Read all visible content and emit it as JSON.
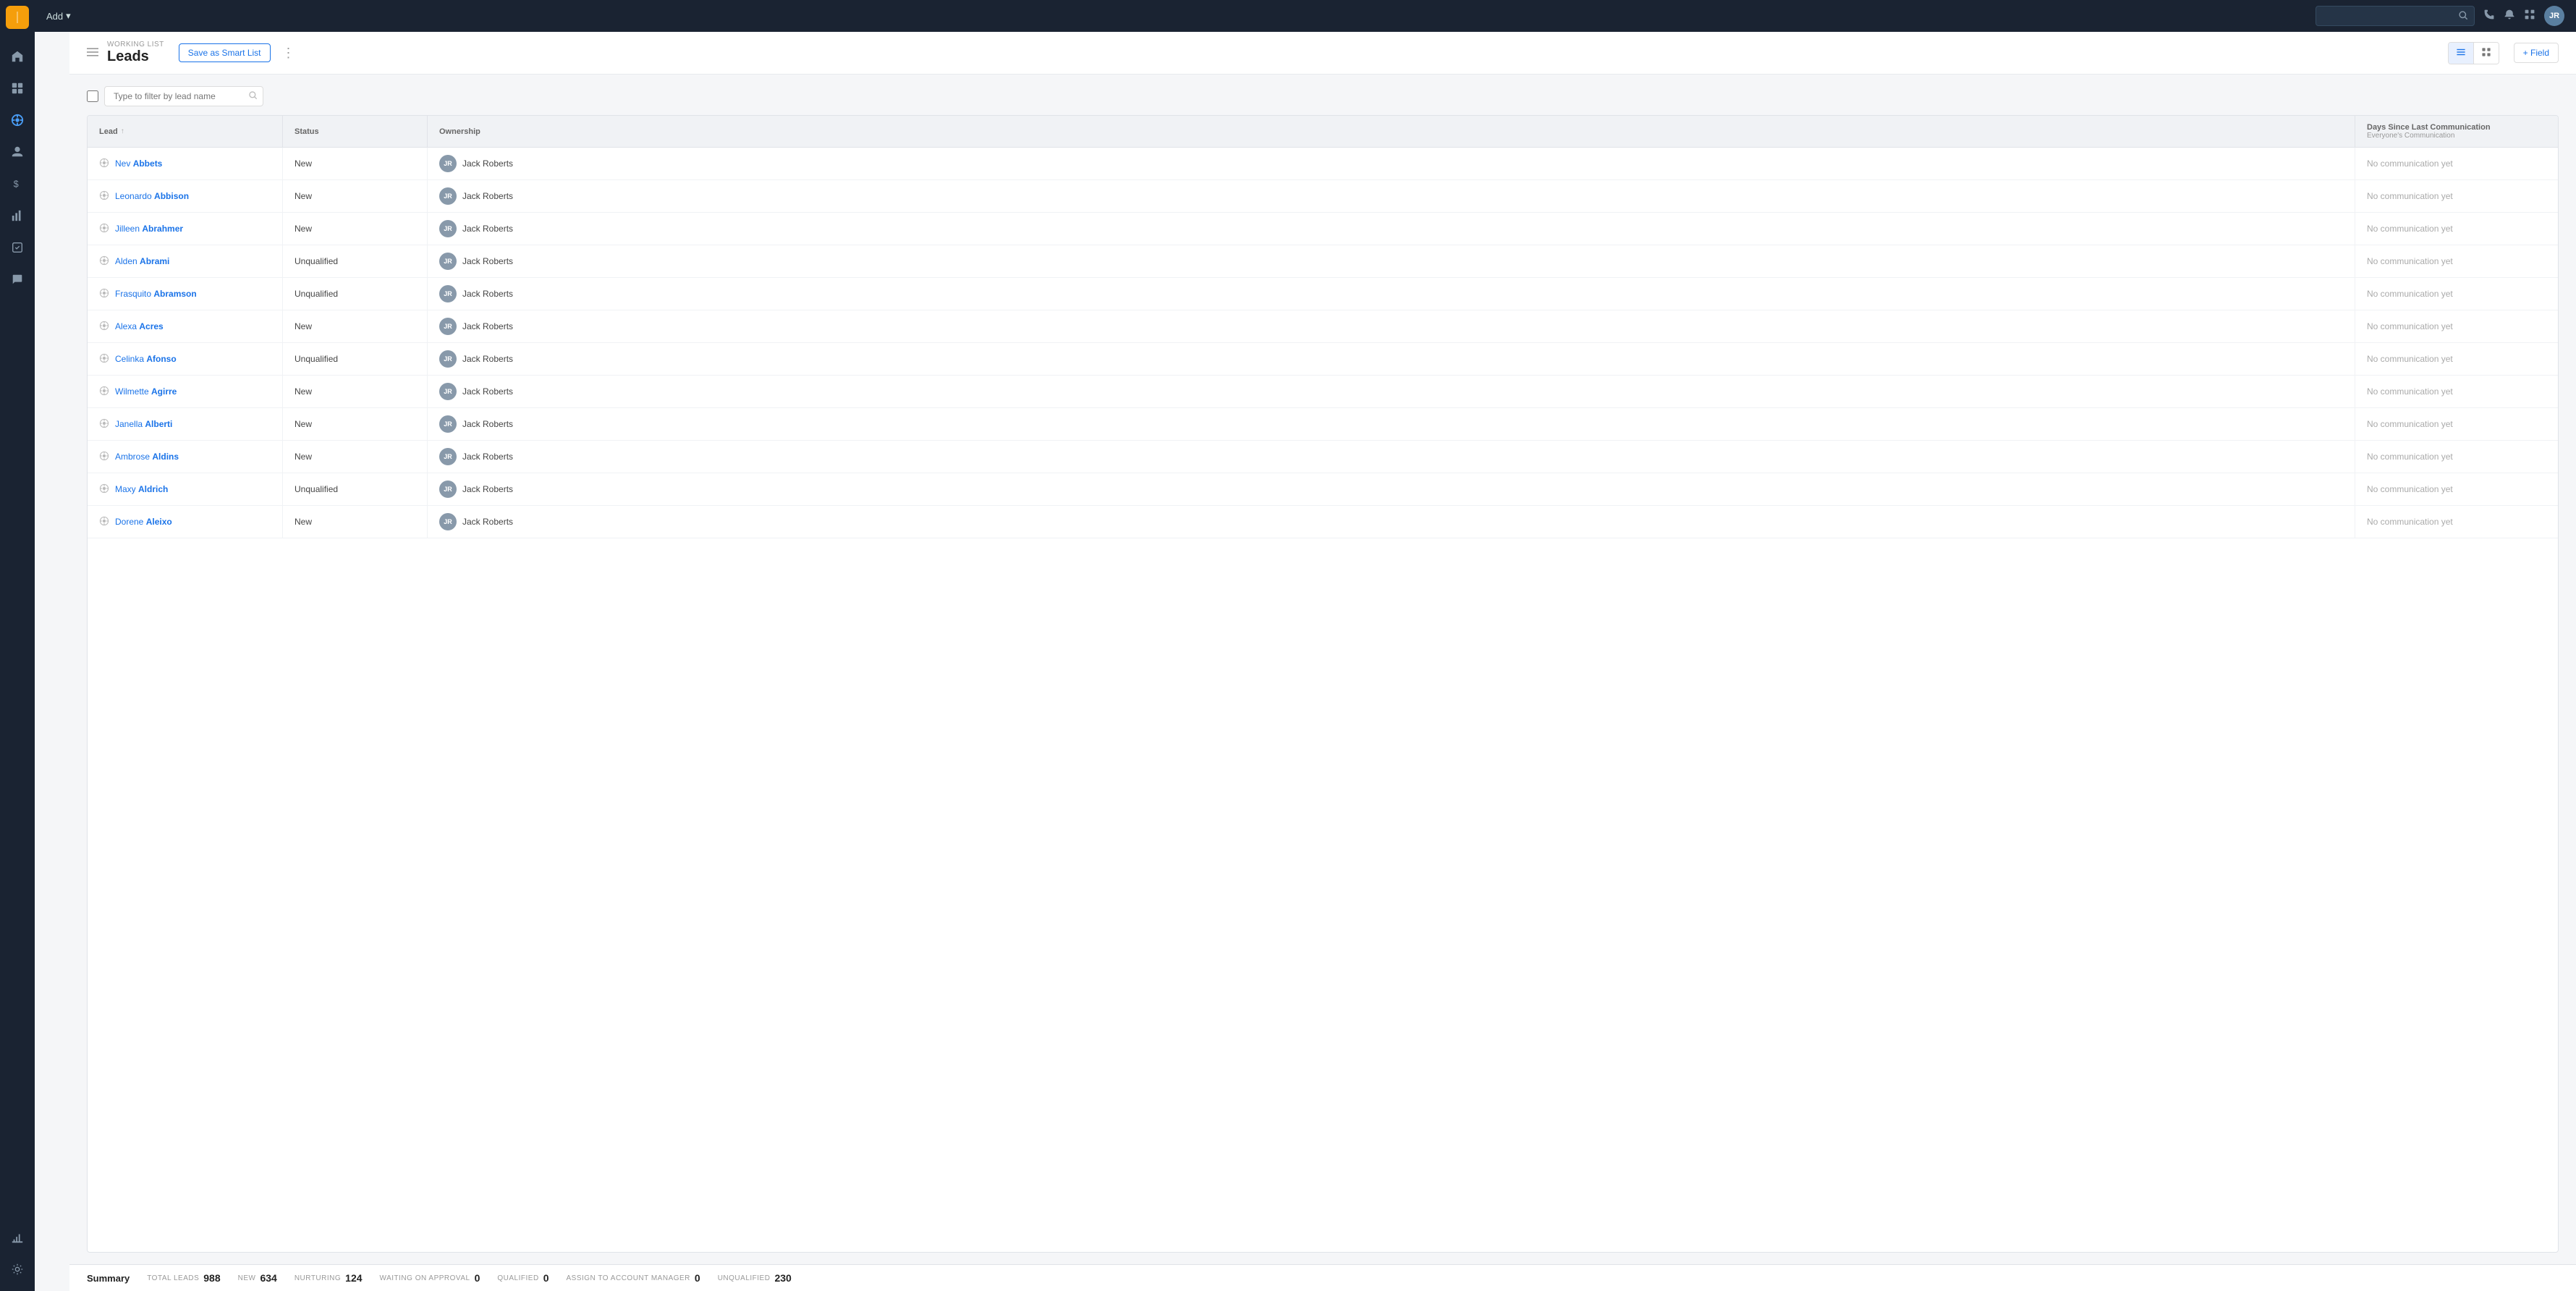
{
  "sidebar": {
    "logo": "Z",
    "items": [
      {
        "id": "home",
        "icon": "⌂",
        "active": false
      },
      {
        "id": "contacts",
        "icon": "◎",
        "active": false
      },
      {
        "id": "leads",
        "icon": "⊕",
        "active": true
      },
      {
        "id": "people",
        "icon": "👤",
        "active": false
      },
      {
        "id": "money",
        "icon": "$",
        "active": false
      },
      {
        "id": "dashboard",
        "icon": "▦",
        "active": false
      },
      {
        "id": "tasks",
        "icon": "✓",
        "active": false
      },
      {
        "id": "messages",
        "icon": "✉",
        "active": false
      },
      {
        "id": "reports",
        "icon": "📊",
        "active": false
      },
      {
        "id": "settings",
        "icon": "⚙",
        "active": false
      }
    ]
  },
  "topbar": {
    "add_label": "Add",
    "search_placeholder": "",
    "user_initials": "JR"
  },
  "header": {
    "breadcrumb": "WORKING LIST",
    "title": "Leads",
    "save_smart_list": "Save as Smart List",
    "add_field": "+ Field"
  },
  "filter": {
    "placeholder": "Type to filter by lead name"
  },
  "table": {
    "columns": [
      {
        "id": "lead",
        "label": "Lead",
        "sortable": true
      },
      {
        "id": "status",
        "label": "Status",
        "sortable": false
      },
      {
        "id": "ownership",
        "label": "Ownership",
        "sortable": false
      },
      {
        "id": "days_comm",
        "label": "Days Since Last Communication",
        "sub": "Everyone's Communication",
        "sortable": false
      }
    ],
    "rows": [
      {
        "id": 1,
        "first": "Nev",
        "last": "Abbets",
        "status": "New",
        "owner": "Jack Roberts",
        "owner_initials": "JR",
        "comm": "No communication yet"
      },
      {
        "id": 2,
        "first": "Leonardo",
        "last": "Abbison",
        "status": "New",
        "owner": "Jack Roberts",
        "owner_initials": "JR",
        "comm": "No communication yet"
      },
      {
        "id": 3,
        "first": "Jilleen",
        "last": "Abrahmer",
        "status": "New",
        "owner": "Jack Roberts",
        "owner_initials": "JR",
        "comm": "No communication yet"
      },
      {
        "id": 4,
        "first": "Alden",
        "last": "Abrami",
        "status": "Unqualified",
        "owner": "Jack Roberts",
        "owner_initials": "JR",
        "comm": "No communication yet"
      },
      {
        "id": 5,
        "first": "Frasquito",
        "last": "Abramson",
        "status": "Unqualified",
        "owner": "Jack Roberts",
        "owner_initials": "JR",
        "comm": "No communication yet"
      },
      {
        "id": 6,
        "first": "Alexa",
        "last": "Acres",
        "status": "New",
        "owner": "Jack Roberts",
        "owner_initials": "JR",
        "comm": "No communication yet"
      },
      {
        "id": 7,
        "first": "Celinka",
        "last": "Afonso",
        "status": "Unqualified",
        "owner": "Jack Roberts",
        "owner_initials": "JR",
        "comm": "No communication yet"
      },
      {
        "id": 8,
        "first": "Wilmette",
        "last": "Agirre",
        "status": "New",
        "owner": "Jack Roberts",
        "owner_initials": "JR",
        "comm": "No communication yet"
      },
      {
        "id": 9,
        "first": "Janella",
        "last": "Alberti",
        "status": "New",
        "owner": "Jack Roberts",
        "owner_initials": "JR",
        "comm": "No communication yet"
      },
      {
        "id": 10,
        "first": "Ambrose",
        "last": "Aldins",
        "status": "New",
        "owner": "Jack Roberts",
        "owner_initials": "JR",
        "comm": "No communication yet"
      },
      {
        "id": 11,
        "first": "Maxy",
        "last": "Aldrich",
        "status": "Unqualified",
        "owner": "Jack Roberts",
        "owner_initials": "JR",
        "comm": "No communication yet"
      },
      {
        "id": 12,
        "first": "Dorene",
        "last": "Aleixo",
        "status": "New",
        "owner": "Jack Roberts",
        "owner_initials": "JR",
        "comm": "No communication yet"
      }
    ]
  },
  "summary": {
    "label": "Summary",
    "total_leads_key": "TOTAL LEADS",
    "total_leads_val": "988",
    "new_key": "NEW",
    "new_val": "634",
    "nurturing_key": "NURTURING",
    "nurturing_val": "124",
    "waiting_key": "WAITING ON APPROVAL",
    "waiting_val": "0",
    "qualified_key": "QUALIFIED",
    "qualified_val": "0",
    "assign_key": "ASSIGN TO ACCOUNT MANAGER",
    "assign_val": "0",
    "unqualified_key": "UNQUALIFIED",
    "unqualified_val": "230"
  }
}
